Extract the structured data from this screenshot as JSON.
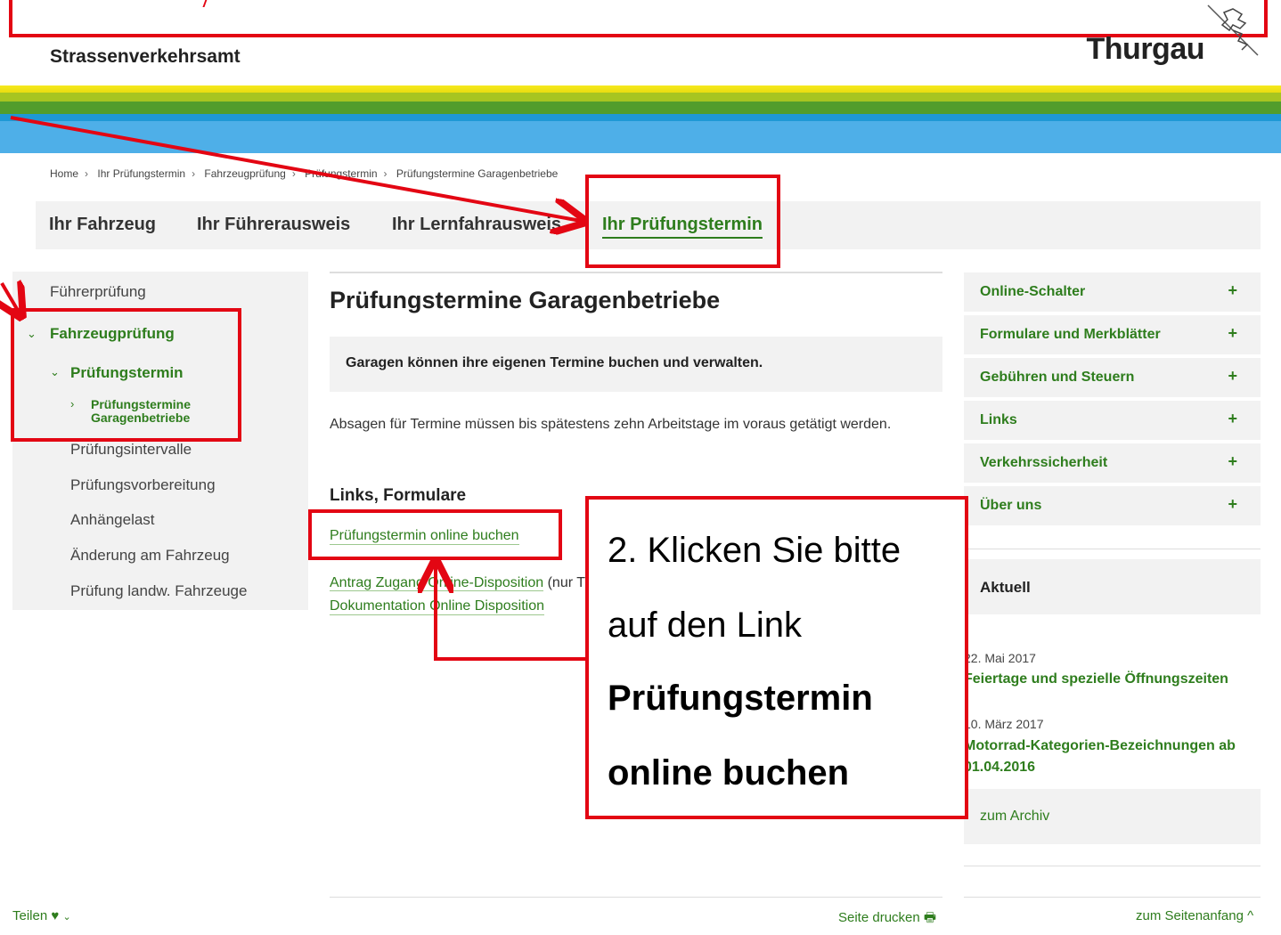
{
  "header": {
    "org_name": "Strassenverkehrsamt",
    "brand": "Thurgau"
  },
  "colors": {
    "accent_green": "#2e7d1d",
    "stripe_yellow": "#f3e100",
    "stripe_lime": "#9bc21c",
    "stripe_green": "#4e9b2d",
    "stripe_blue": "#1f9ad6",
    "stripe_sky": "#4aaee8",
    "annotation_red": "#e30613"
  },
  "breadcrumb": [
    "Home",
    "Ihr Prüfungstermin",
    "Fahrzeugprüfung",
    "Prüfungstermin",
    "Prüfungstermine Garagenbetriebe"
  ],
  "top_nav": {
    "tabs": [
      "Ihr Fahrzeug",
      "Ihr Führerausweis",
      "Ihr Lernfahrausweis",
      "Ihr Prüfungstermin"
    ],
    "active": "Ihr Prüfungstermin"
  },
  "left_nav": {
    "items": [
      "Führerprüfung",
      "Fahrzeugprüfung",
      "Prüfungstermin",
      "Prüfungstermine Garagenbetriebe",
      "Prüfungsintervalle",
      "Prüfungsvorbereitung",
      "Anhängelast",
      "Änderung am Fahrzeug",
      "Prüfung landw. Fahrzeuge"
    ]
  },
  "main": {
    "title": "Prüfungstermine Garagenbetriebe",
    "lead": "Garagen können ihre eigenen Termine buchen und verwalten.",
    "body": "Absagen für Termine müssen bis spätestens zehn Arbeitstage im voraus getätigt werden.",
    "links_heading": "Links, Formulare",
    "link_book": "Prüfungstermin online buchen",
    "link_access": "Antrag Zugang Online-Disposition",
    "link_access_note": "(nur Thurgauer Garagisten)",
    "link_docs": "Dokumentation Online Disposition"
  },
  "right_nav": {
    "accordion": [
      "Online-Schalter",
      "Formulare und Merkblätter",
      "Gebühren und Steuern",
      "Links",
      "Verkehrssicherheit",
      "Über uns"
    ],
    "plus_symbol": "+",
    "news_heading": "Aktuell",
    "news": [
      {
        "date": "22. Mai 2017",
        "title": "Feiertage und spezielle Öffnungszeiten"
      },
      {
        "date": "10. März 2017",
        "title": "Motorrad-Kategorien-Bezeichnungen ab 01.04.2016"
      }
    ],
    "archive": "zum Archiv"
  },
  "footer": {
    "share": "Teilen",
    "print": "Seite drucken",
    "to_top": "zum Seitenanfang"
  },
  "annotation": {
    "line1": "2. Klicken Sie bitte",
    "line2": "auf den Link",
    "line3": "Prüfungstermin",
    "line4": "online buchen"
  }
}
